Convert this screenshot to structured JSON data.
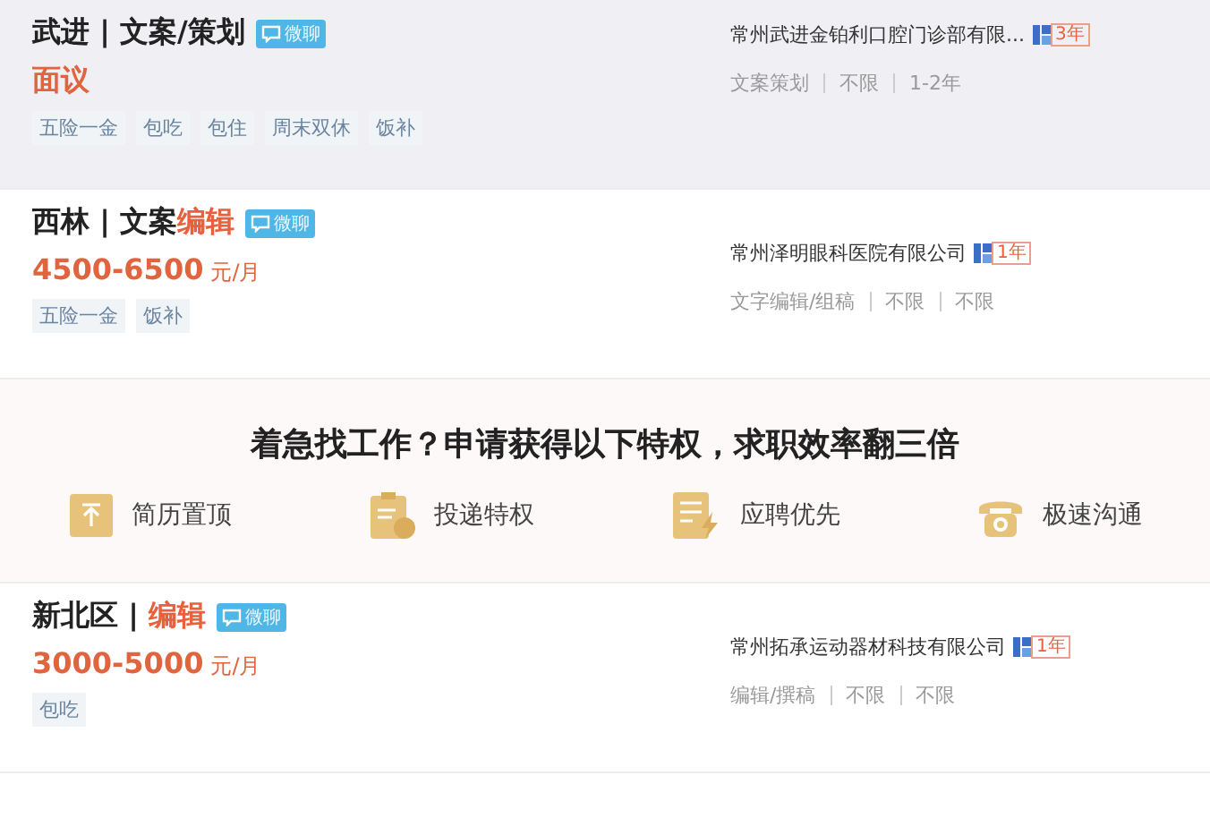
{
  "jobs": [
    {
      "selected": true,
      "title": [
        {
          "text": "武进 | 文案/策划",
          "highlight": false
        }
      ],
      "chat_badge": "微聊",
      "salary": "面议",
      "company": "常州武进金铂利口腔门诊部有限...",
      "years_badge": "3年",
      "meta": [
        "文案策划",
        "不限",
        "1-2年"
      ],
      "tags": [
        "五险一金",
        "包吃",
        "包住",
        "周末双休",
        "饭补"
      ]
    },
    {
      "selected": false,
      "title": [
        {
          "text": "西林 | 文案",
          "highlight": false
        },
        {
          "text": "编辑",
          "highlight": true
        }
      ],
      "chat_badge": "微聊",
      "salary": "4500-6500",
      "salary_unit": "元/月",
      "company": "常州泽明眼科医院有限公司",
      "years_badge": "1年",
      "meta": [
        "文字编辑/组稿",
        "不限",
        "不限"
      ],
      "tags": [
        "五险一金",
        "饭补"
      ]
    },
    {
      "kind": "promo",
      "headline": "着急找工作？申请获得以下特权，求职效率翻三倍",
      "perks": [
        {
          "kind": "top",
          "label": "简历置顶"
        },
        {
          "kind": "deliver",
          "label": "投递特权"
        },
        {
          "kind": "priority",
          "label": "应聘优先"
        },
        {
          "kind": "phone",
          "label": "极速沟通"
        }
      ]
    },
    {
      "selected": false,
      "title": [
        {
          "text": "新北区 | ",
          "highlight": false
        },
        {
          "text": "编辑",
          "highlight": true
        }
      ],
      "chat_badge": "微聊",
      "salary": "3000-5000",
      "salary_unit": "元/月",
      "company": "常州拓承运动器材科技有限公司",
      "years_badge": "1年",
      "meta": [
        "编辑/撰稿",
        "不限",
        "不限"
      ],
      "tags": [
        "包吃"
      ]
    }
  ]
}
